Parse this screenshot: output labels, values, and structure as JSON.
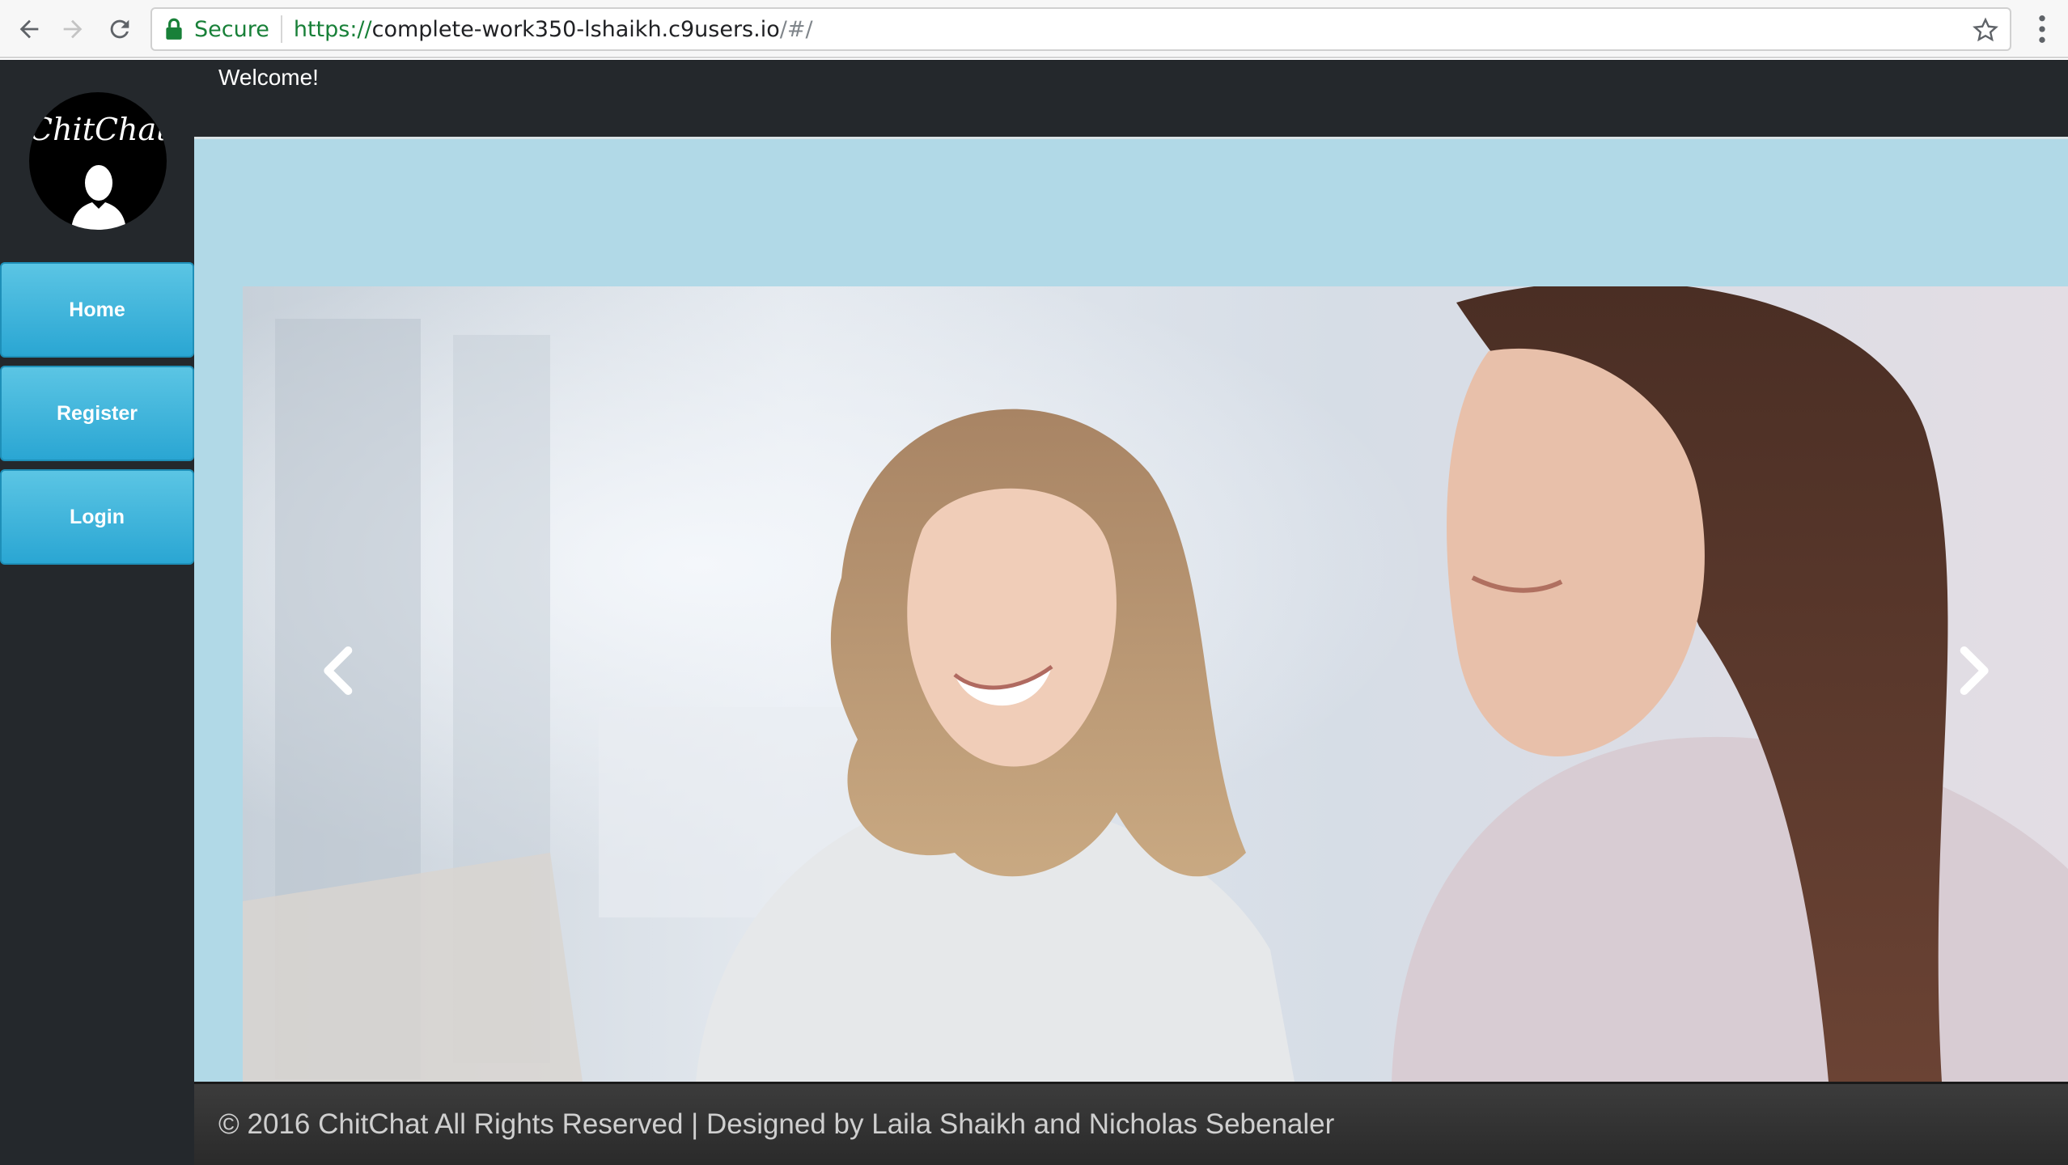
{
  "browser": {
    "secure_label": "Secure",
    "url_scheme": "https://",
    "url_host": "complete-work350-lshaikh.c9users.io",
    "url_path": "/#/"
  },
  "sidebar": {
    "logo_text": "ChitChat",
    "items": [
      {
        "label": "Home"
      },
      {
        "label": "Register"
      },
      {
        "label": "Login"
      }
    ]
  },
  "header": {
    "welcome": "Welcome!"
  },
  "footer": {
    "text": "© 2016 ChitChat All Rights Reserved | Designed by Laila Shaikh and Nicholas Sebenaler"
  },
  "theme": {
    "sidebar_bg": "#24282c",
    "content_bg": "#b1d9e7",
    "button_color": "#2aa6d3",
    "secure_green": "#188038"
  }
}
